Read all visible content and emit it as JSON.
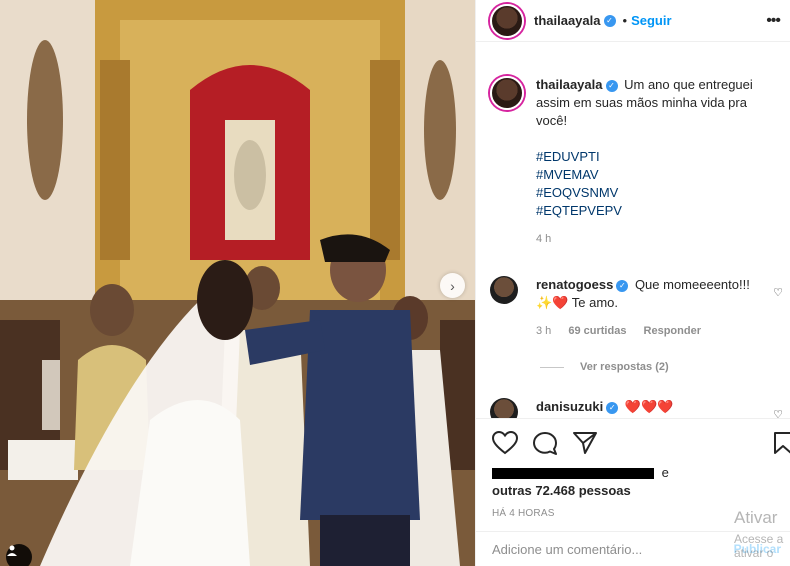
{
  "post": {
    "username": "thailaayala",
    "follow_label": "Seguir",
    "caption": "Um ano que entreguei assim em suas mãos minha vida pra você!",
    "hashtags": [
      "#EDUVPTI",
      "#MVEMAV",
      "#EOQVSNMV",
      "#EQTEPVEPV"
    ],
    "caption_time": "4 h"
  },
  "comments": [
    {
      "username": "renatogoess",
      "text": "Que momeeeento!!! ✨❤️ Te amo.",
      "time": "3 h",
      "likes": "69 curtidas",
      "reply_label": "Responder",
      "view_replies": "Ver respostas (2)"
    },
    {
      "username": "danisuzuki",
      "text": "❤️❤️❤️"
    }
  ],
  "likes": {
    "suffix": "e",
    "others": "outras 72.468 pessoas"
  },
  "timestamp": "HÁ 4 HORAS",
  "add_comment": {
    "placeholder": "Adicione um comentário...",
    "publish_label": "Publicar"
  },
  "watermark": {
    "line1": "Ativar",
    "line2": "Acesse a",
    "line3": "ativar o"
  },
  "icons": {
    "heart": "heart-icon",
    "comment": "comment-icon",
    "share": "share-icon",
    "save": "bookmark-icon",
    "more": "more-icon",
    "next": "chevron-right-icon",
    "tag": "user-tag-icon"
  },
  "colors": {
    "link": "#0095f6",
    "hashtag": "#00376b",
    "verified": "#3897f0",
    "muted": "#8e8e8e"
  }
}
